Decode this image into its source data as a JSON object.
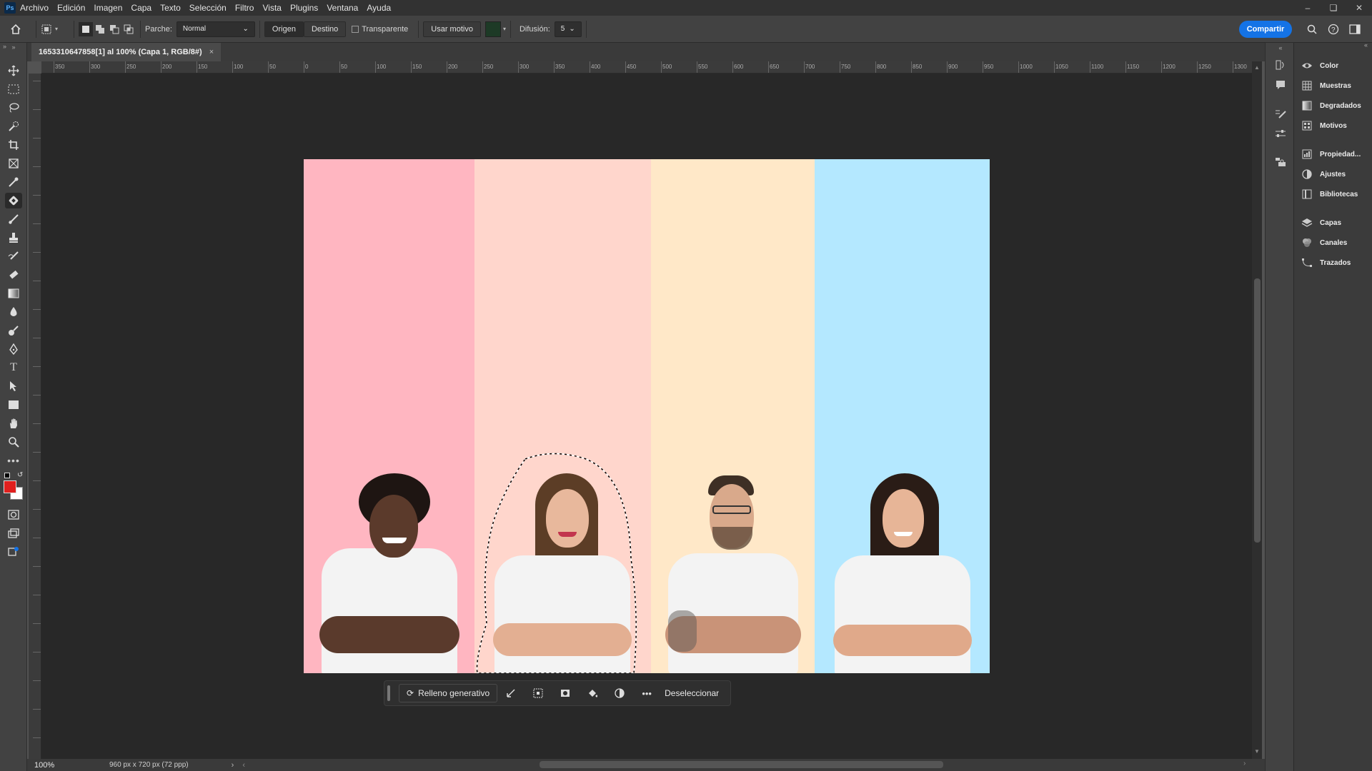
{
  "menu": {
    "app_badge": "Ps",
    "items": [
      "Archivo",
      "Edición",
      "Imagen",
      "Capa",
      "Texto",
      "Selección",
      "Filtro",
      "Vista",
      "Plugins",
      "Ventana",
      "Ayuda"
    ]
  },
  "options": {
    "patch_label": "Parche:",
    "patch_mode": "Normal",
    "source_btn": "Origen",
    "dest_btn": "Destino",
    "transparent_label": "Transparente",
    "use_pattern_btn": "Usar motivo",
    "diffusion_label": "Difusión:",
    "diffusion_value": "5",
    "share_btn": "Compartir"
  },
  "document": {
    "tab_title": "1653310647858[1] al 100% (Capa 1, RGB/8#)",
    "zoom": "100%",
    "size_info": "960 px x 720 px (72 ppp)"
  },
  "ruler": {
    "h_labels": [
      "350",
      "300",
      "250",
      "200",
      "150",
      "100",
      "50",
      "0",
      "50",
      "100",
      "150",
      "200",
      "250",
      "300",
      "350",
      "400",
      "450",
      "500",
      "550",
      "600",
      "650",
      "700",
      "750",
      "800",
      "850",
      "900",
      "950",
      "1000",
      "1050",
      "1100",
      "1150",
      "1200",
      "1250",
      "1300"
    ]
  },
  "context_bar": {
    "generative_fill": "Relleno generativo",
    "deselect": "Deseleccionar"
  },
  "panels": [
    {
      "icon": "color-icon",
      "label": "Color"
    },
    {
      "icon": "swatches-icon",
      "label": "Muestras"
    },
    {
      "icon": "gradients-icon",
      "label": "Degradados"
    },
    {
      "icon": "patterns-icon",
      "label": "Motivos"
    },
    {
      "icon": "properties-icon",
      "label": "Propiedad..."
    },
    {
      "icon": "adjustments-icon",
      "label": "Ajustes"
    },
    {
      "icon": "libraries-icon",
      "label": "Bibliotecas"
    },
    {
      "icon": "layers-icon",
      "label": "Capas"
    },
    {
      "icon": "channels-icon",
      "label": "Canales"
    },
    {
      "icon": "paths-icon",
      "label": "Trazados"
    }
  ],
  "colors": {
    "foreground": "#e0201e",
    "background": "#ffffff",
    "stripe1": "#ffb6c1",
    "stripe2": "#ffd6cc",
    "stripe3": "#ffe8c8",
    "stripe4": "#b4e8ff",
    "accent": "#1473e6"
  }
}
